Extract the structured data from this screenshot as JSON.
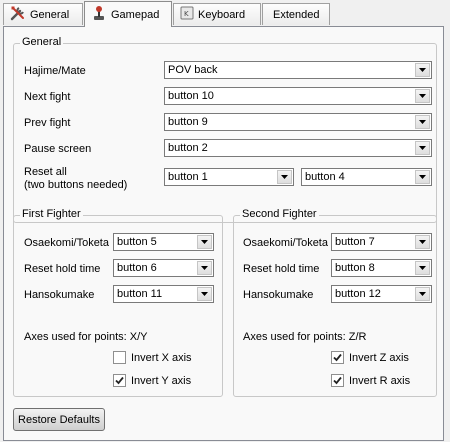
{
  "tabs": [
    {
      "label": "General",
      "icon": "wrench-screwdriver-icon"
    },
    {
      "label": "Gamepad",
      "icon": "joystick-icon",
      "active": true
    },
    {
      "label": "Keyboard",
      "icon": "keyboard-icon"
    },
    {
      "label": "Extended"
    }
  ],
  "general": {
    "title": "General",
    "hajime": {
      "label": "Hajime/Mate",
      "value": "POV back"
    },
    "next": {
      "label": "Next fight",
      "value": "button 10"
    },
    "prev": {
      "label": "Prev fight",
      "value": "button 9"
    },
    "pause": {
      "label": "Pause screen",
      "value": "button 2"
    },
    "reset": {
      "label1": "Reset all",
      "label2": "(two buttons needed)",
      "value1": "button 1",
      "value2": "button 4"
    }
  },
  "first": {
    "title": "First Fighter",
    "osaekomi": {
      "label": "Osaekomi/Toketa",
      "value": "button 5"
    },
    "resethold": {
      "label": "Reset hold time",
      "value": "button 6"
    },
    "hansoku": {
      "label": "Hansokumake",
      "value": "button 11"
    },
    "axes": "Axes used for points: X/Y",
    "invert1": {
      "label": "Invert X axis",
      "checked": false
    },
    "invert2": {
      "label": "Invert Y axis",
      "checked": true
    }
  },
  "second": {
    "title": "Second Fighter",
    "osaekomi": {
      "label": "Osaekomi/Toketa",
      "value": "button 7"
    },
    "resethold": {
      "label": "Reset hold time",
      "value": "button 8"
    },
    "hansoku": {
      "label": "Hansokumake",
      "value": "button 12"
    },
    "axes": "Axes used for points: Z/R",
    "invert1": {
      "label": "Invert Z axis",
      "checked": true
    },
    "invert2": {
      "label": "Invert R axis",
      "checked": true
    }
  },
  "restore_label": "Restore Defaults"
}
